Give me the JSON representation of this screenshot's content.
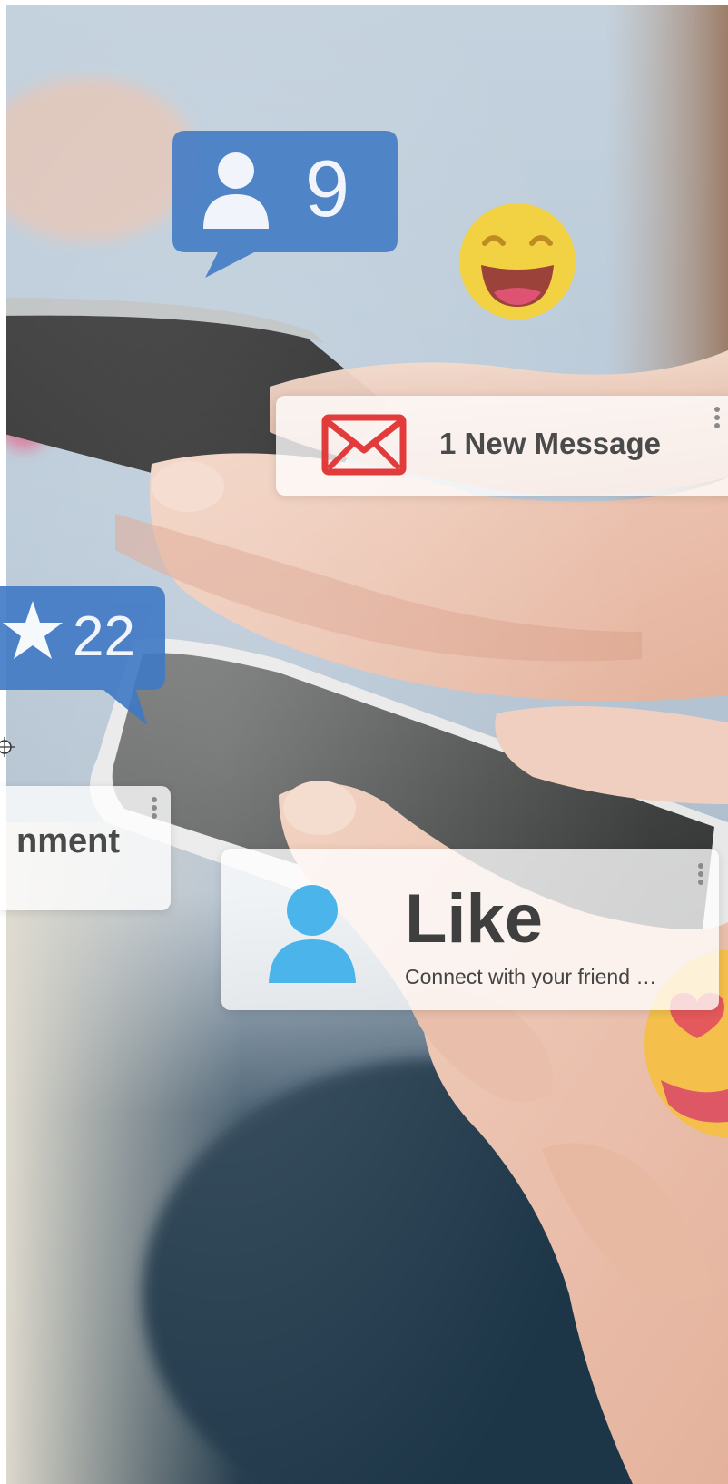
{
  "scene": {
    "description_free": true,
    "colors": {
      "badge_blue": "#3f79c4",
      "message_red": "#e23b3b",
      "person_icon_blue": "#4bb4ea",
      "emoji_yellow": "#f7d232",
      "emoji_mouth": "#d8446a"
    }
  },
  "notifications": {
    "message": {
      "text": "1 New Message",
      "icon": "envelope-icon"
    },
    "like": {
      "title": "Like",
      "subtitle": "Connect with your friend …",
      "icon": "person-icon"
    },
    "comment": {
      "text": "nment"
    }
  },
  "badges": {
    "friends": {
      "count": "9",
      "icon": "person-icon"
    },
    "stars": {
      "count": "22",
      "icon": "star-icon"
    }
  },
  "icons": {
    "emoji_top": "laughing-emoji-icon",
    "emoji_bottom": "heart-eyes-emoji-icon",
    "kebab": "vertical-dots-icon",
    "crosshair": "crosshair-icon"
  }
}
